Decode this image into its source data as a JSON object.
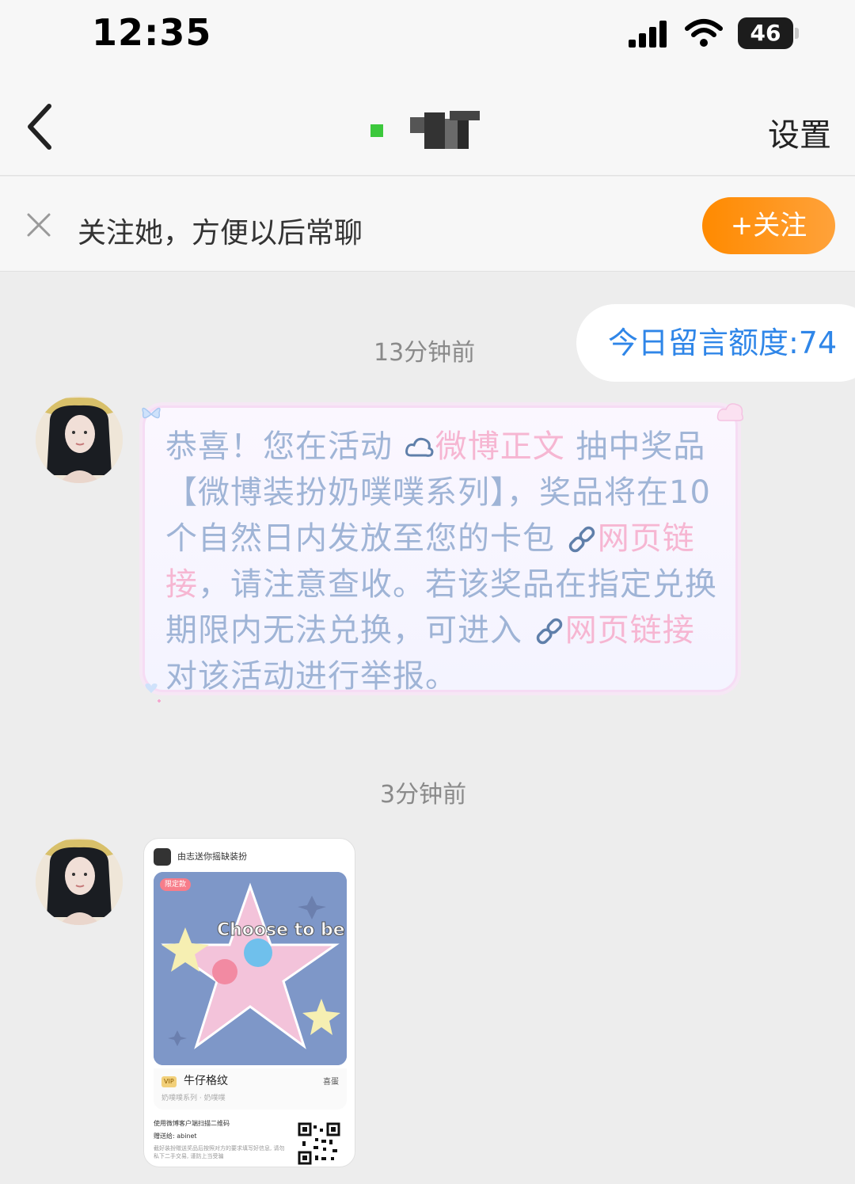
{
  "status_bar": {
    "time": "12:35",
    "battery": "46",
    "icons": [
      "signal-icon",
      "wifi-icon",
      "battery-icon"
    ]
  },
  "nav": {
    "back_icon": "chevron-left-icon",
    "settings_label": "设置"
  },
  "follow_banner": {
    "close_icon": "close-icon",
    "text": "关注她，方便以后常聊",
    "follow_label": "+关注",
    "follow_color": "#ff8a00"
  },
  "chat": {
    "quota": "今日留言额度:74",
    "messages": [
      {
        "time": "13分钟前",
        "parts": {
          "p1": "恭喜！您在活动 ",
          "link1": "微博正文",
          "p2": " 抽中奖品【微博装扮奶噗噗系列】，奖品将在10个自然日内发放至您的卡包 ",
          "link2": "网页链接",
          "p3": "，请注意查收。若该奖品在指定兑换期限内无法兑换，可进入 ",
          "link3": "网页链接",
          "p4": " 对该活动进行举报。"
        },
        "icons": [
          "cloud-icon",
          "link-icon",
          "link-icon"
        ]
      },
      {
        "time": "3分钟前",
        "card": {
          "header": "由志送你摇缺装扮",
          "badge": "限定款",
          "artwork_text": "Choose to be soft",
          "tag": "VIP",
          "name": "牛仔格纹",
          "right_label": "喜蛋",
          "sub": "奶噗噗系列 · 奶噗噗",
          "foot1": "使用微博客户端扫描二维码",
          "foot2": "赠送给: abinet",
          "foot3": "截好装扮赠送奖品后按照对方的要求填写好信息, 请勿私下二手交易, 谨防上当受骗"
        }
      }
    ]
  },
  "colors": {
    "message_text": "#9fb4d6",
    "link_text": "#f6b6d2",
    "quota_text": "#2f86e8"
  }
}
